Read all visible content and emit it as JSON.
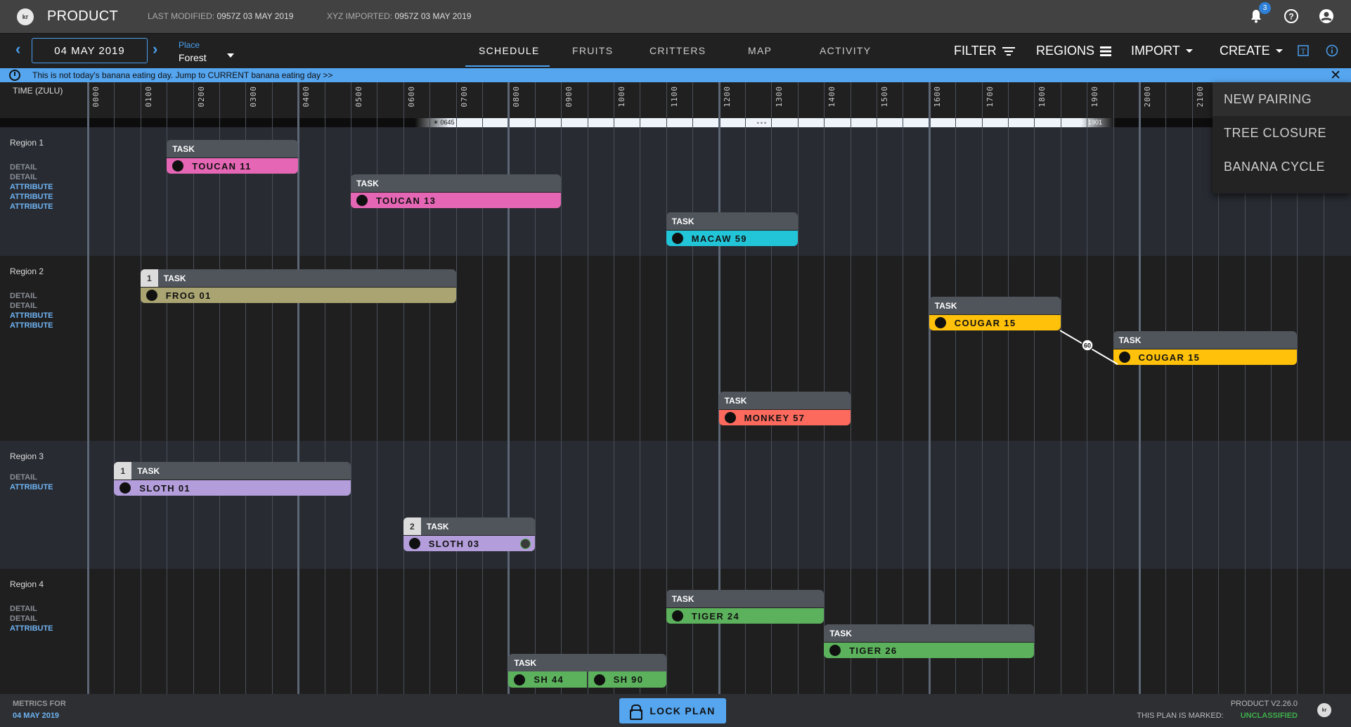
{
  "header": {
    "app_title": "PRODUCT",
    "last_modified_label": "LAST MODIFIED:",
    "last_modified_value": "0957Z 03 MAY 2019",
    "imported_label": "XYZ IMPORTED:",
    "imported_value": "0957Z 03 MAY 2019",
    "notification_count": "3",
    "icons": [
      "bell-icon",
      "help-icon",
      "account-icon"
    ]
  },
  "nav": {
    "date": "04 MAY 2019",
    "place_label": "Place",
    "place_value": "Forest",
    "tabs": [
      {
        "label": "SCHEDULE",
        "active": true
      },
      {
        "label": "FRUITS",
        "active": false
      },
      {
        "label": "CRITTERS",
        "active": false
      },
      {
        "label": "MAP",
        "active": false
      },
      {
        "label": "ACTIVITY",
        "active": false
      }
    ],
    "actions": {
      "filter": "FILTER",
      "regions": "REGIONS",
      "import": "IMPORT",
      "create": "CREATE"
    }
  },
  "banner": {
    "text": "This is not today's banana eating day. Jump to CURRENT banana eating day >>",
    "close": "✕"
  },
  "timeline": {
    "label": "TIME (ZULU)",
    "hours": [
      "0000",
      "0100",
      "0200",
      "0300",
      "0400",
      "0500",
      "0600",
      "0700",
      "0800",
      "0900",
      "1000",
      "1100",
      "1200",
      "1300",
      "1400",
      "1500",
      "1600",
      "1700",
      "1800",
      "1900",
      "2000",
      "2100"
    ],
    "sunrise": "0645",
    "sunset": "1901",
    "dots": "•••"
  },
  "regions": [
    {
      "name": "Region 1",
      "lines": [
        {
          "t": "DETAIL",
          "k": "detail"
        },
        {
          "t": "DETAIL",
          "k": "detail"
        },
        {
          "t": "ATTRIBUTE",
          "k": "attr"
        },
        {
          "t": "ATTRIBUTE",
          "k": "attr"
        },
        {
          "t": "ATTRIBUTE",
          "k": "attr"
        }
      ]
    },
    {
      "name": "Region 2",
      "lines": [
        {
          "t": "DETAIL",
          "k": "detail"
        },
        {
          "t": "DETAIL",
          "k": "detail"
        },
        {
          "t": "ATTRIBUTE",
          "k": "attr"
        },
        {
          "t": "ATTRIBUTE",
          "k": "attr"
        }
      ]
    },
    {
      "name": "Region 3",
      "lines": [
        {
          "t": "DETAIL",
          "k": "detail"
        },
        {
          "t": "ATTRIBUTE",
          "k": "attr"
        }
      ]
    },
    {
      "name": "Region 4",
      "lines": [
        {
          "t": "DETAIL",
          "k": "detail"
        },
        {
          "t": "DETAIL",
          "k": "detail"
        },
        {
          "t": "ATTRIBUTE",
          "k": "attr"
        }
      ]
    }
  ],
  "tasks": [
    {
      "header": "TASK",
      "name": "TOUCAN 11",
      "color": "#e466b4",
      "start": "0130",
      "end": "0400"
    },
    {
      "header": "TASK",
      "name": "TOUCAN 13",
      "color": "#e466b4",
      "start": "0500",
      "end": "0900"
    },
    {
      "header": "TASK",
      "name": "MACAW 59",
      "color": "#22c4d8",
      "start": "1100",
      "end": "1330"
    },
    {
      "header": "TASK",
      "seq": "1",
      "name": "FROG 01",
      "color": "#a9a471",
      "start": "0100",
      "end": "0700"
    },
    {
      "header": "TASK",
      "name": "COUGAR 15",
      "color": "#ffc10a",
      "start": "1600",
      "end": "1830"
    },
    {
      "header": "TASK",
      "name": "COUGAR 15",
      "color": "#ffc10a",
      "start": "1930",
      "end": "2300"
    },
    {
      "header": "TASK",
      "name": "MONKEY 57",
      "color": "#fc6a5e",
      "start": "1200",
      "end": "1430"
    },
    {
      "header": "TASK",
      "seq": "1",
      "name": "SLOTH 01",
      "color": "#b39ddb",
      "start": "0030",
      "end": "0500"
    },
    {
      "header": "TASK",
      "seq": "2",
      "name": "SLOTH 03",
      "color": "#b39ddb",
      "start": "0600",
      "end": "0830",
      "fuel_icon": true
    },
    {
      "header": "TASK",
      "name": "TIGER 24",
      "color": "#5cb25c",
      "start": "1100",
      "end": "1400"
    },
    {
      "header": "TASK",
      "name": "TIGER 26",
      "color": "#5cb25c",
      "start": "1400",
      "end": "1800"
    },
    {
      "header": "TASK",
      "name": "SH 44",
      "name2": "SH 90",
      "color": "#5cb25c",
      "start": "0800",
      "end": "1100"
    }
  ],
  "connector_label": "60",
  "create_menu": [
    "NEW PAIRING",
    "TREE CLOSURE",
    "BANANA  CYCLE"
  ],
  "footer": {
    "metrics_label": "METRICS FOR",
    "metrics_date": "04 MAY 2019",
    "lock_label": "LOCK PLAN",
    "version": "PRODUCT V2.26.0",
    "marked_label": "THIS PLAN IS MARKED:",
    "classification": "UNCLASSIFIED"
  }
}
